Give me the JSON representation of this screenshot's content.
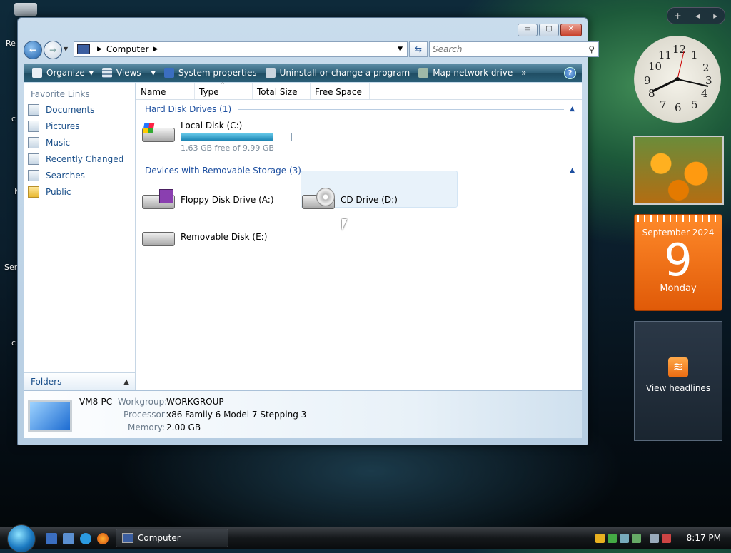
{
  "desktop": {
    "partial_labels": [
      "Re",
      "c",
      "N",
      "Ser",
      "c"
    ]
  },
  "window": {
    "title_buttons": {
      "minimize": "▭",
      "maximize": "▢",
      "close": "✕"
    },
    "address": {
      "label": "Computer"
    },
    "search": {
      "placeholder": "Search"
    },
    "toolbar": {
      "organize": "Organize",
      "views": "Views",
      "system_properties": "System properties",
      "uninstall": "Uninstall or change a program",
      "map_drive": "Map network drive",
      "more": "»"
    },
    "sidebar": {
      "title": "Favorite Links",
      "links": [
        "Documents",
        "Pictures",
        "Music",
        "Recently Changed",
        "Searches",
        "Public"
      ],
      "folders": "Folders"
    },
    "columns": [
      "Name",
      "Type",
      "Total Size",
      "Free Space"
    ],
    "groups": {
      "hdd": "Hard Disk Drives (1)",
      "removable": "Devices with Removable Storage (3)"
    },
    "drives": {
      "c": {
        "name": "Local Disk (C:)",
        "free_text": "1.63 GB free of 9.99 GB",
        "used_fraction": 0.84
      },
      "a": {
        "name": "Floppy Disk Drive (A:)"
      },
      "d": {
        "name": "CD Drive (D:)"
      },
      "e": {
        "name": "Removable Disk (E:)"
      }
    },
    "details": {
      "computer_name": "VM8-PC",
      "workgroup_label": "Workgroup:",
      "workgroup": "WORKGROUP",
      "processor_label": "Processor:",
      "processor": "x86 Family 6 Model 7 Stepping 3",
      "memory_label": "Memory:",
      "memory": "2.00 GB"
    }
  },
  "sidebar_gadgets": {
    "clock_numbers": [
      "12",
      "1",
      "2",
      "3",
      "4",
      "5",
      "6",
      "7",
      "8",
      "9",
      "10",
      "11"
    ],
    "calendar": {
      "month": "September 2024",
      "day": "9",
      "weekday": "Monday"
    },
    "feeds": {
      "label": "View headlines"
    }
  },
  "taskbar": {
    "task_label": "Computer",
    "time": "8:17 PM"
  },
  "colors": {
    "accent": "#1a4f8a",
    "toolbar": "#2f6078",
    "calendar": "#e05a08"
  }
}
